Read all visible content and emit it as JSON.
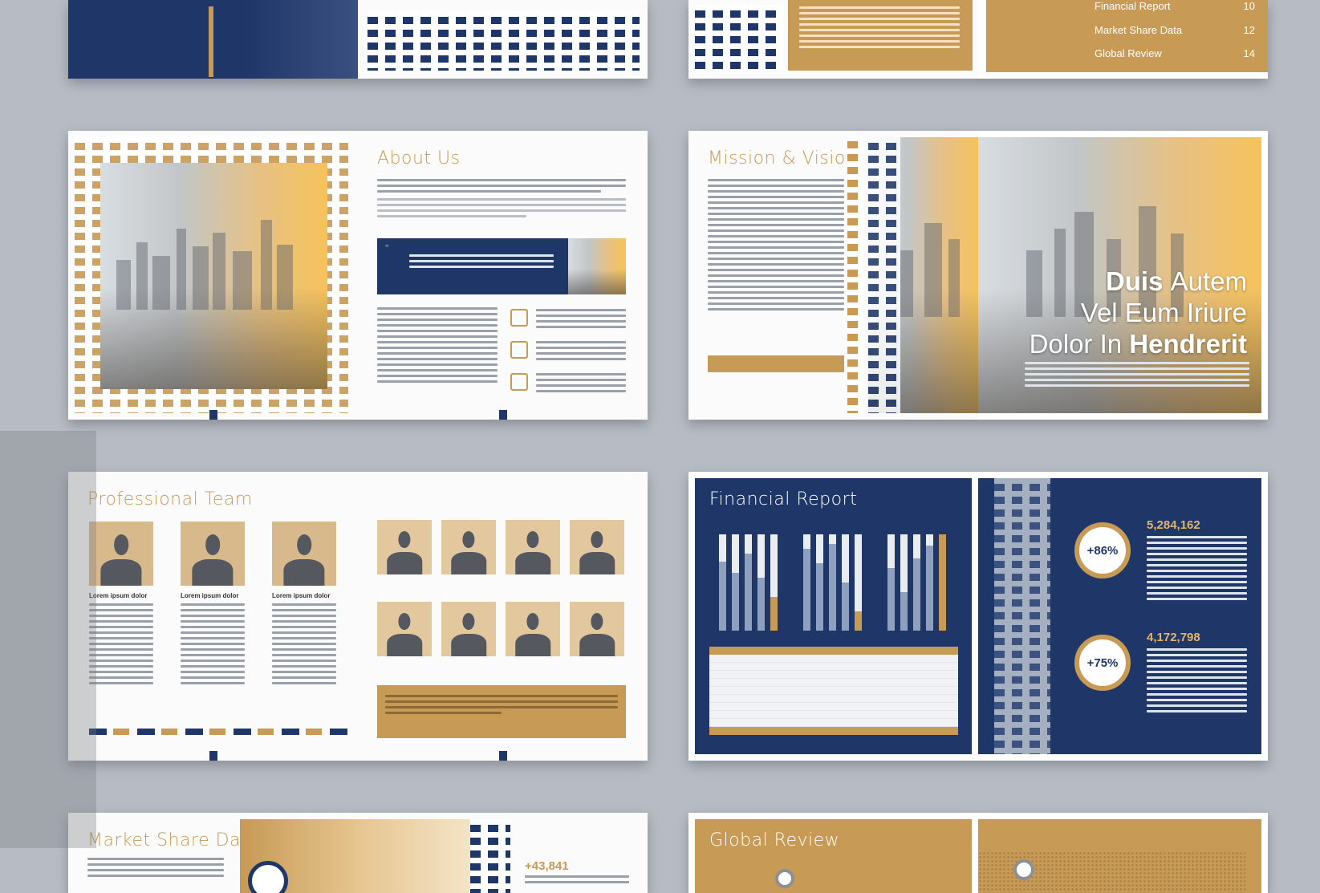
{
  "spreads": {
    "about": {
      "title": "About Us",
      "quote": "“"
    },
    "mission": {
      "title": "Mission & Vision",
      "headline_line1_bold": "Duis",
      "headline_line1_light": "Autem",
      "headline_line2": "Vel Eum Iriure",
      "headline_line3_light": "Dolor In",
      "headline_line3_bold": "Hendrerit"
    },
    "team": {
      "title": "Professional Team",
      "member_label": "Lorem ipsum dolor"
    },
    "financial": {
      "title": "Financial Report",
      "stat1_value": "5,284,162",
      "stat1_pct": "+86%",
      "stat2_value": "4,172,798",
      "stat2_pct": "+75%"
    },
    "market": {
      "title": "Market Share Data",
      "stat_value": "+43,841"
    },
    "global": {
      "title": "Global Review"
    },
    "toc": {
      "rows": [
        {
          "label": "Financial Report",
          "page": "10"
        },
        {
          "label": "Market Share Data",
          "page": "12"
        },
        {
          "label": "Global Review",
          "page": "14"
        }
      ]
    }
  },
  "colors": {
    "navy": "#1f3768",
    "gold": "#c79a55",
    "background": "#b7bcc4"
  }
}
